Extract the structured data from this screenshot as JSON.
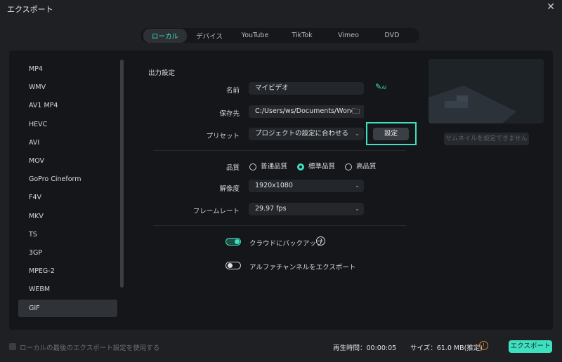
{
  "window": {
    "title": "エクスポート",
    "close_icon": "close-icon"
  },
  "tabs": [
    "ローカル",
    "デバイス",
    "YouTube",
    "TikTok",
    "Vimeo",
    "DVD"
  ],
  "formats": [
    "MP4",
    "WMV",
    "AV1 MP4",
    "HEVC",
    "AVI",
    "MOV",
    "GoPro Cineform",
    "F4V",
    "MKV",
    "TS",
    "3GP",
    "MPEG-2",
    "WEBM",
    "GIF"
  ],
  "selected_format": "GIF",
  "output": {
    "section_title": "出力設定",
    "name_label": "名前",
    "name_value": "マイビデオ",
    "path_label": "保存先",
    "path_value": "C:/Users/ws/Documents/Wondershare",
    "preset_label": "プリセット",
    "preset_value": "プロジェクトの設定に合わせる",
    "preset_settings_button": "設定",
    "quality_label": "品質",
    "quality_options": [
      "普通品質",
      "標準品質",
      "高品質"
    ],
    "quality_selected": "標準品質",
    "resolution_label": "解像度",
    "resolution_value": "1920x1080",
    "framerate_label": "フレームレート",
    "framerate_value": "29.97 fps",
    "cloud_backup_label": "クラウドにバックアップ",
    "cloud_backup_on": true,
    "alpha_label": "アルファチャンネルをエクスポート",
    "alpha_on": false
  },
  "thumbnail": {
    "button": "サムネイルを設定できません"
  },
  "footer": {
    "use_last_label": "ローカルの最後のエクスポート設定を使用する",
    "duration": "再生時間：00:00:05",
    "size": "サイズ：61.0 MB(推定)",
    "export_button": "エクスポート"
  },
  "colors": {
    "accent": "#3fe0c0",
    "highlight_border": "#3fe0c0",
    "warning": "#e0862c"
  }
}
